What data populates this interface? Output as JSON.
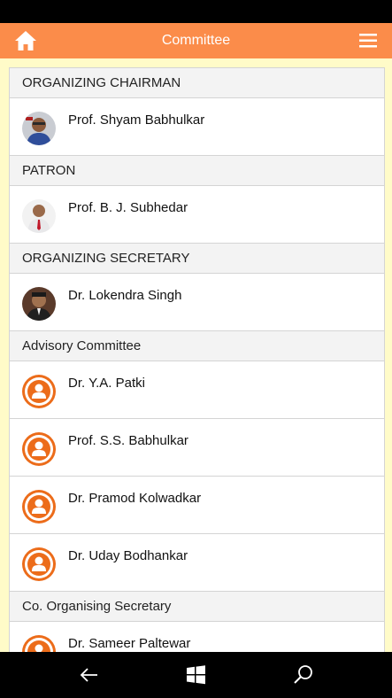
{
  "header": {
    "title": "Committee",
    "home_icon": "home-icon",
    "menu_icon": "hamburger-menu-icon",
    "bg_color": "#fb8c4a"
  },
  "sections": [
    {
      "title": "ORGANIZING CHAIRMAN",
      "members": [
        {
          "name": "Prof. Shyam Babhulkar",
          "avatar": "photo"
        }
      ]
    },
    {
      "title": "PATRON",
      "members": [
        {
          "name": "Prof. B. J. Subhedar",
          "avatar": "photo"
        }
      ]
    },
    {
      "title": "ORGANIZING SECRETARY",
      "members": [
        {
          "name": "Dr. Lokendra Singh",
          "avatar": "photo"
        }
      ]
    },
    {
      "title": "Advisory Committee",
      "members": [
        {
          "name": "Dr. Y.A. Patki",
          "avatar": "generic-user-icon"
        },
        {
          "name": "Prof. S.S. Babhulkar",
          "avatar": "generic-user-icon"
        },
        {
          "name": "Dr. Pramod Kolwadkar",
          "avatar": "generic-user-icon"
        },
        {
          "name": "Dr. Uday Bodhankar",
          "avatar": "generic-user-icon"
        }
      ]
    },
    {
      "title": "Co. Organising Secretary",
      "members": [
        {
          "name": "Dr. Sameer Paltewar",
          "avatar": "generic-user-icon"
        }
      ]
    }
  ],
  "nav_bar": {
    "back_icon": "back-arrow-icon",
    "windows_icon": "windows-logo-icon",
    "search_icon": "search-icon"
  }
}
